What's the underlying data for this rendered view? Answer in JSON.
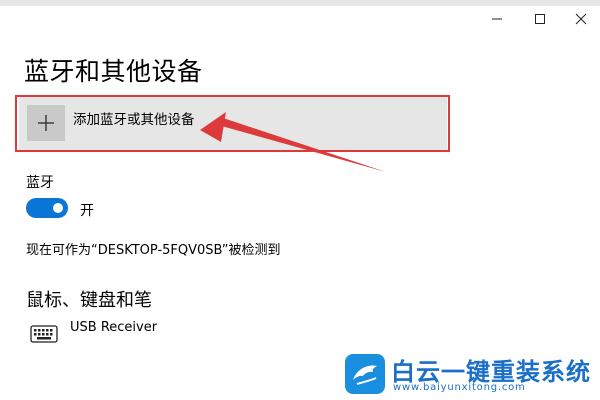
{
  "window": {
    "minimize_icon": "minimize-icon",
    "maximize_icon": "maximize-icon",
    "close_icon": "close-icon"
  },
  "page": {
    "title": "蓝牙和其他设备"
  },
  "add_device": {
    "label": "添加蓝牙或其他设备",
    "icon": "plus-icon"
  },
  "annotation": {
    "color": "#dd3b3b"
  },
  "bluetooth": {
    "label": "蓝牙",
    "toggle_on": true,
    "state_text": "开",
    "accent_color": "#0b76d6",
    "discoverable_text": "现在可作为“DESKTOP-5FQV0SB”被检测到"
  },
  "peripherals": {
    "section_title": "鼠标、键盘和笔",
    "devices": [
      {
        "icon": "keyboard-icon",
        "name": "USB Receiver"
      }
    ]
  },
  "watermark": {
    "brand": "白云一键重装系统",
    "url": "www.baiyunxitong.com",
    "color": "#1a6fc8"
  }
}
